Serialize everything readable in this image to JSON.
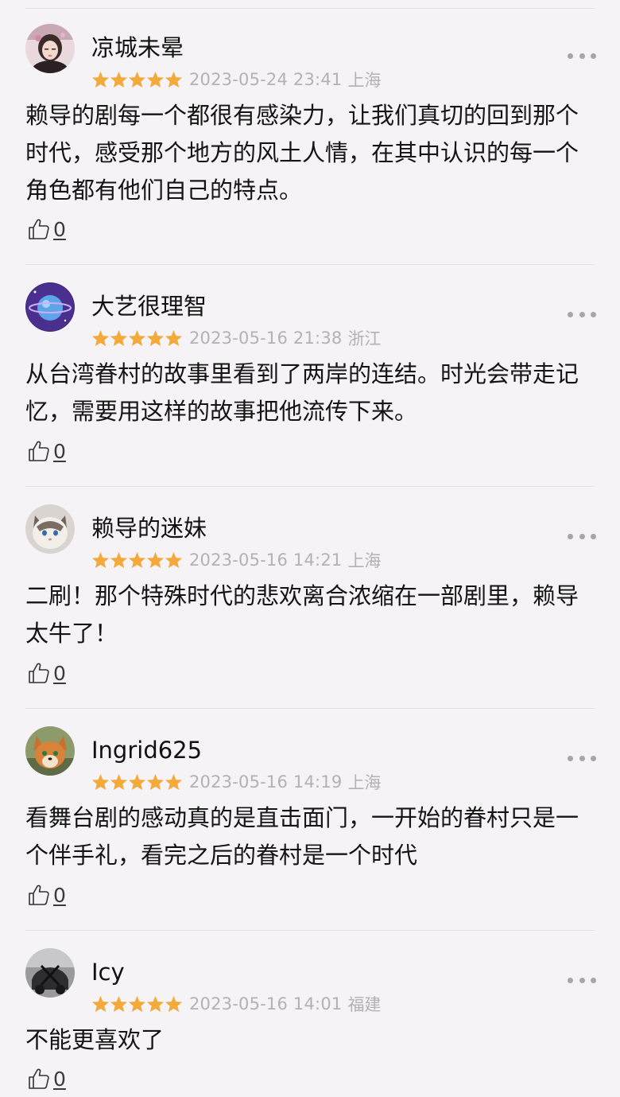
{
  "colors": {
    "star": "#f4a93b",
    "background": "#f5f3f5",
    "meta_text": "#b4b1b4"
  },
  "comments": [
    {
      "username": "凉城未晕",
      "avatar": "avatar-girl",
      "rating": 5,
      "date": "2023-05-24 23:41",
      "location": "上海",
      "text": "赖导的剧每一个都很有感染力，让我们真切的回到那个时代，感受那个地方的风土人情，在其中认识的每一个角色都有他们自己的特点。",
      "likes": "0"
    },
    {
      "username": "大艺很理智",
      "avatar": "avatar-planet",
      "rating": 5,
      "date": "2023-05-16 21:38",
      "location": "浙江",
      "text": "从台湾眷村的故事里看到了两岸的连结。时光会带走记忆，需要用这样的故事把他流传下来。",
      "likes": "0"
    },
    {
      "username": "赖导的迷妹",
      "avatar": "avatar-cat",
      "rating": 5,
      "date": "2023-05-16 14:21",
      "location": "上海",
      "text": "二刷！那个特殊时代的悲欢离合浓缩在一部剧里，赖导太牛了！",
      "likes": "0"
    },
    {
      "username": "Ingrid625",
      "avatar": "avatar-fox",
      "rating": 5,
      "date": "2023-05-16 14:19",
      "location": "上海",
      "text": "看舞台剧的感动真的是直击面门，一开始的眷村只是一个伴手礼，看完之后的眷村是一个时代",
      "likes": "0"
    },
    {
      "username": "Icy",
      "avatar": "avatar-car",
      "rating": 5,
      "date": "2023-05-16 14:01",
      "location": "福建",
      "text": "不能更喜欢了",
      "likes": "0"
    }
  ]
}
